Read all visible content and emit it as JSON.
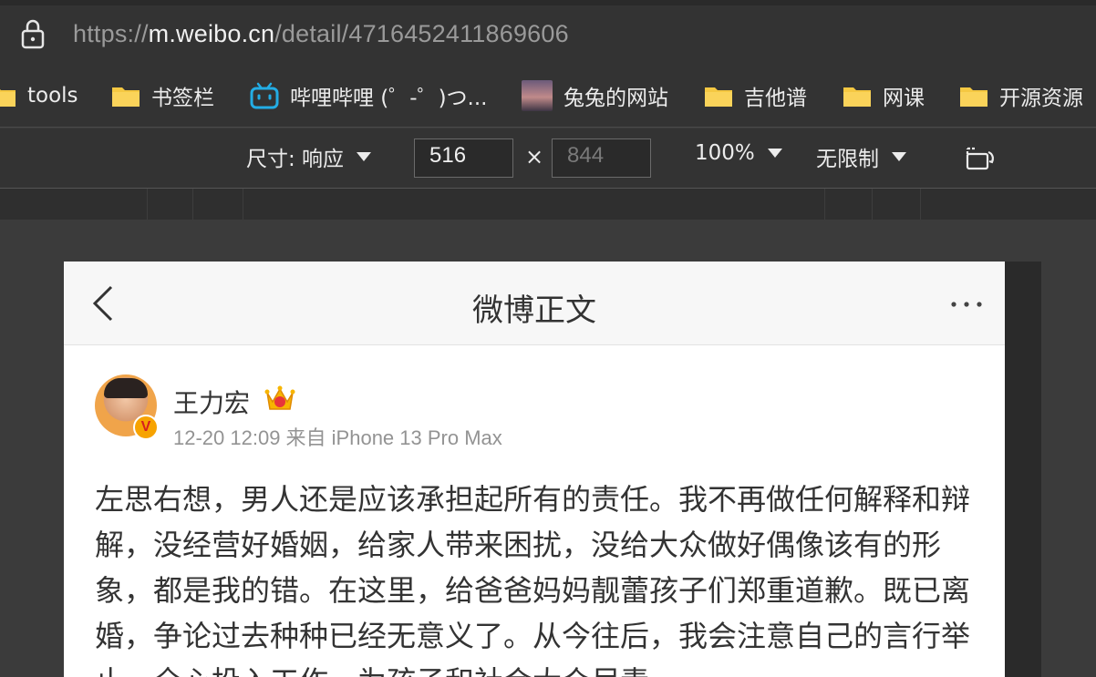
{
  "browser": {
    "url_scheme": "https://",
    "url_host": "m.weibo.cn",
    "url_path": "/detail/4716452411869606"
  },
  "bookmarks": [
    {
      "label": "tools",
      "icon": "folder-icon"
    },
    {
      "label": "书签栏",
      "icon": "folder-icon"
    },
    {
      "label": "哔哩哔哩 (゜-゜)つ...",
      "icon": "bilibili-icon"
    },
    {
      "label": "兔兔的网站",
      "icon": "site-thumbnail"
    },
    {
      "label": "吉他谱",
      "icon": "folder-icon"
    },
    {
      "label": "网课",
      "icon": "folder-icon"
    },
    {
      "label": "开源资源",
      "icon": "folder-icon"
    }
  ],
  "devtools": {
    "size_label": "尺寸: 响应",
    "width": "516",
    "height_placeholder": "844",
    "times": "×",
    "zoom": "100%",
    "throttle": "无限制"
  },
  "weibo": {
    "nav_title": "微博正文",
    "user_name": "王力宏",
    "verified_badge": "V",
    "meta": "12-20 12:09 来自 iPhone 13 Pro Max",
    "post_text": "左思右想，男人还是应该承担起所有的责任。我不再做任何解释和辩解，没经营好婚姻，给家人带来困扰，没给大众做好偶像该有的形象，都是我的错。在这里，给爸爸妈妈靓蕾孩子们郑重道歉。既已离婚，争论过去种种已经无意义了。从今往后，我会注意自己的言行举止，全心投入工作，为孩子和社会大众尽责"
  },
  "colors": {
    "folder": "#f5c842",
    "bilibili": "#23ade5",
    "badge": "#f7a300"
  }
}
